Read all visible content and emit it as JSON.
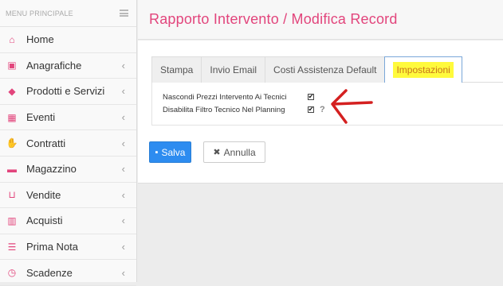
{
  "sidebar": {
    "header": "MENU PRINCIPALE",
    "items": [
      {
        "label": "Home",
        "icon": "home-icon",
        "glyph": "⌂",
        "chevron": false
      },
      {
        "label": "Anagrafiche",
        "icon": "contact-card-icon",
        "glyph": "▣",
        "chevron": true
      },
      {
        "label": "Prodotti e Servizi",
        "icon": "tags-icon",
        "glyph": "◆",
        "chevron": true
      },
      {
        "label": "Eventi",
        "icon": "calendar-check-icon",
        "glyph": "▦",
        "chevron": true
      },
      {
        "label": "Contratti",
        "icon": "handshake-icon",
        "glyph": "✋",
        "chevron": true
      },
      {
        "label": "Magazzino",
        "icon": "truck-icon",
        "glyph": "▬",
        "chevron": true
      },
      {
        "label": "Vendite",
        "icon": "shopping-basket-icon",
        "glyph": "⊔",
        "chevron": true
      },
      {
        "label": "Acquisti",
        "icon": "barcode-icon",
        "glyph": "▥",
        "chevron": true
      },
      {
        "label": "Prima Nota",
        "icon": "list-icon",
        "glyph": "☰",
        "chevron": true
      },
      {
        "label": "Scadenze",
        "icon": "clock-icon",
        "glyph": "◷",
        "chevron": true
      }
    ],
    "chevron_glyph": "‹"
  },
  "header": {
    "title": "Rapporto Intervento  /  Modifica Record"
  },
  "tabs": [
    {
      "label": "Stampa"
    },
    {
      "label": "Invio Email"
    },
    {
      "label": "Costi Assistenza Default"
    },
    {
      "label": "Impostazioni"
    }
  ],
  "settings": {
    "row1_label": "Nascondi Prezzi Intervento Ai Tecnici",
    "row1_checked": "✔",
    "row2_label": "Disabilita Filtro Tecnico Nel Planning",
    "row2_checked": "✔",
    "help": "?"
  },
  "buttons": {
    "save": "Salva",
    "cancel": "Annulla",
    "save_icon": "▪",
    "cancel_icon": "✖"
  },
  "colors": {
    "accent": "#e2457c",
    "primary": "#2d8cf0",
    "highlight": "#fffa3c",
    "arrow": "#d42020"
  }
}
